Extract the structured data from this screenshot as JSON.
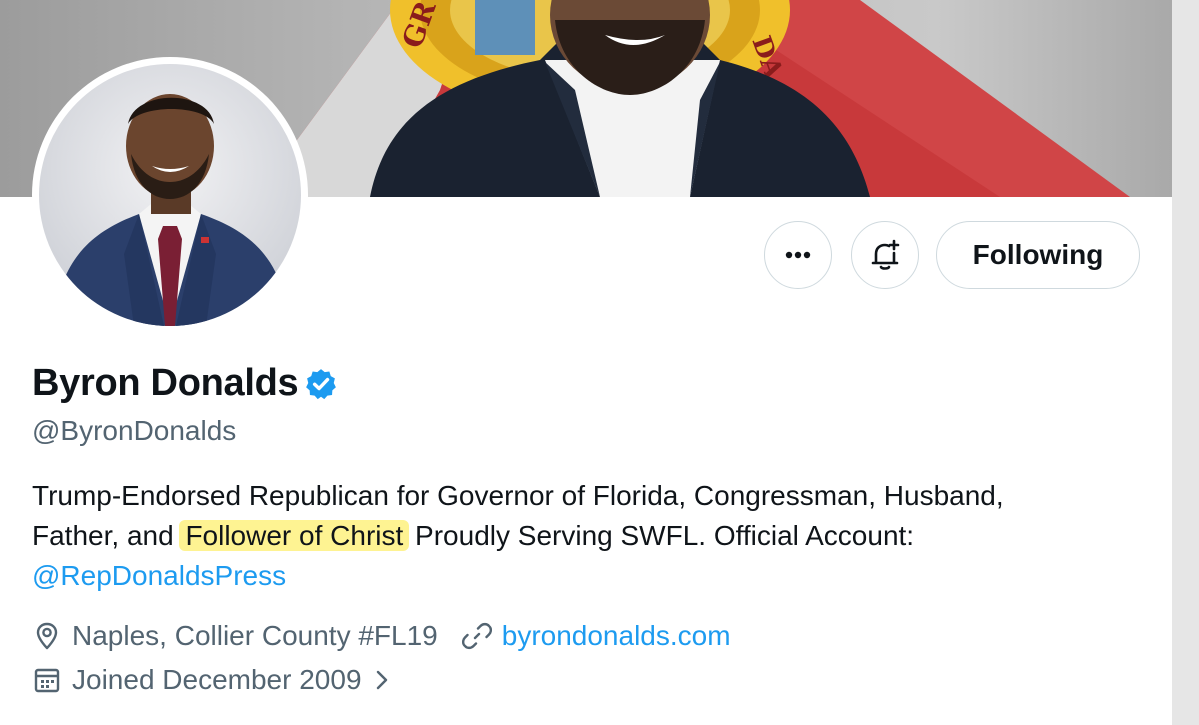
{
  "profile": {
    "display_name": "Byron Donalds",
    "handle": "@ByronDonalds",
    "verified_icon": "verified-badge-icon",
    "bio": {
      "line1": "Trump-Endorsed Republican for Governor of Florida, Congressman, Husband,",
      "line2_before": "Father, and ",
      "line2_highlight": "Follower of Christ",
      "line2_after": " Proudly Serving SWFL. Official Account:",
      "mention": "@RepDonaldsPress"
    },
    "location": "Naples, Collier County #FL19",
    "website": "byrondonalds.com",
    "joined": "Joined December 2009"
  },
  "actions": {
    "more_icon": "more-horizontal-icon",
    "notify_icon": "bell-plus-icon",
    "follow_label": "Following"
  },
  "colors": {
    "link": "#1d9bf0",
    "secondary_text": "#536471",
    "highlight": "#fef392",
    "verified": "#1d9bf0"
  }
}
